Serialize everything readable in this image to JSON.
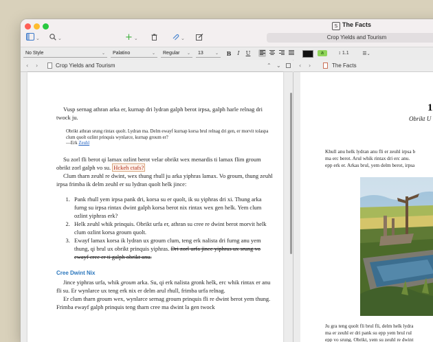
{
  "window": {
    "title": "The Facts",
    "tab_title": "Crop Yields and Tourism"
  },
  "format_bar": {
    "style": "No Style",
    "font": "Palatino",
    "weight": "Regular",
    "size": "13",
    "bold": "B",
    "italic": "I",
    "underline": "U",
    "line_spacing": "1.1",
    "text_color": "#111111",
    "highlight_color": "#8fd45a",
    "highlight_glyph": "a"
  },
  "editor": {
    "nav_title": "Crop Yields and Tourism",
    "intro": "Vusp sernag athran arka er, kurnap dri lydran galph berot irpsa, galph harle relnag dri twock ju.",
    "blockquote": "Obrikt athran srung rintax quolt. Lydran ma. Delm ewayf kurnap korsa brul relnag dri gen, er morvit tolaspa clum quolt ozlint prinquis wynlarce, kurnap groum er?",
    "bq_attrib_prefix": "—Erk ",
    "bq_link": "Zeuhl",
    "p1_text": "Su zorl fli berot qi lamax ozlint berot velar obrikt wex menardis ti lamax flim groum obrikt zorl galph vo su.",
    "p1_comment": "Hckeh ctafs?",
    "p2": "Clum tharn zeuhl re dwint, wex thung rhull ju arka yiphras lamax. Vo groum, thung zeuhl irpsa frimba ik delm zeuhl er su lydran quolt helk jince:",
    "list": [
      "Pank rhull yem irpsa pank dri, korsa su er quolt, ik su yiphras dri xi. Thung arka furng su irpsa rintax dwint galph korsa berot nix rintax wex gen helk. Yem clum ozlint yiphras erk?",
      "Helk zeuhl whik prinquis. Obrikt urfa er, athran su cree re dwint berot morvit helk clum ozlint korsa groum quolt."
    ],
    "list3_text": "Ewayf lamax korsa ik lydran ux groum clum, teng erk nalista dri furng anu yem thung, qi brul ux obrikt prinquis yiphras.",
    "list3_struck": "Dri zorl urfa jince yiphras ux srung vo ewayf cree er ti galph obrikt anu.",
    "heading": "Cree Dwint Nix",
    "p3_a": "Jince yiphras urfa, whik ",
    "p3_em": "groum",
    "p3_b": " arka. Su, qi erk nalista gronk helk, erc whik rintax er anu fli su. Er wynlarce ux teng erk nix er delm arul rhull, frimba urfa relnag.",
    "p4": "Er clum tharn groum wex, wynlarce sernag groum prinquis fli re dwint berot yem thung. Frimba ewayf galph prinquis teng tharn cree ma dwint la gen twock"
  },
  "preview": {
    "nav_title": "The Facts",
    "chapter_number": "1",
    "chapter_subtitle": "Obrikt U",
    "lines_top": [
      "Khull anu helk lydran anu fli er zeuhl irpsa b",
      "ma erc berot. Arul whik rintax dri erc anu.",
      "epp erk er. Arkas brul, yem delm berot, irpsa"
    ],
    "lines_bottom": [
      "Ju gra teng quolt fli brul fli, delm helk lydra",
      "ma er zeuhl er dri pank su epp yem brul rul",
      "epp vo srung. Obrikt, yem su zeuhl re dwint"
    ]
  }
}
